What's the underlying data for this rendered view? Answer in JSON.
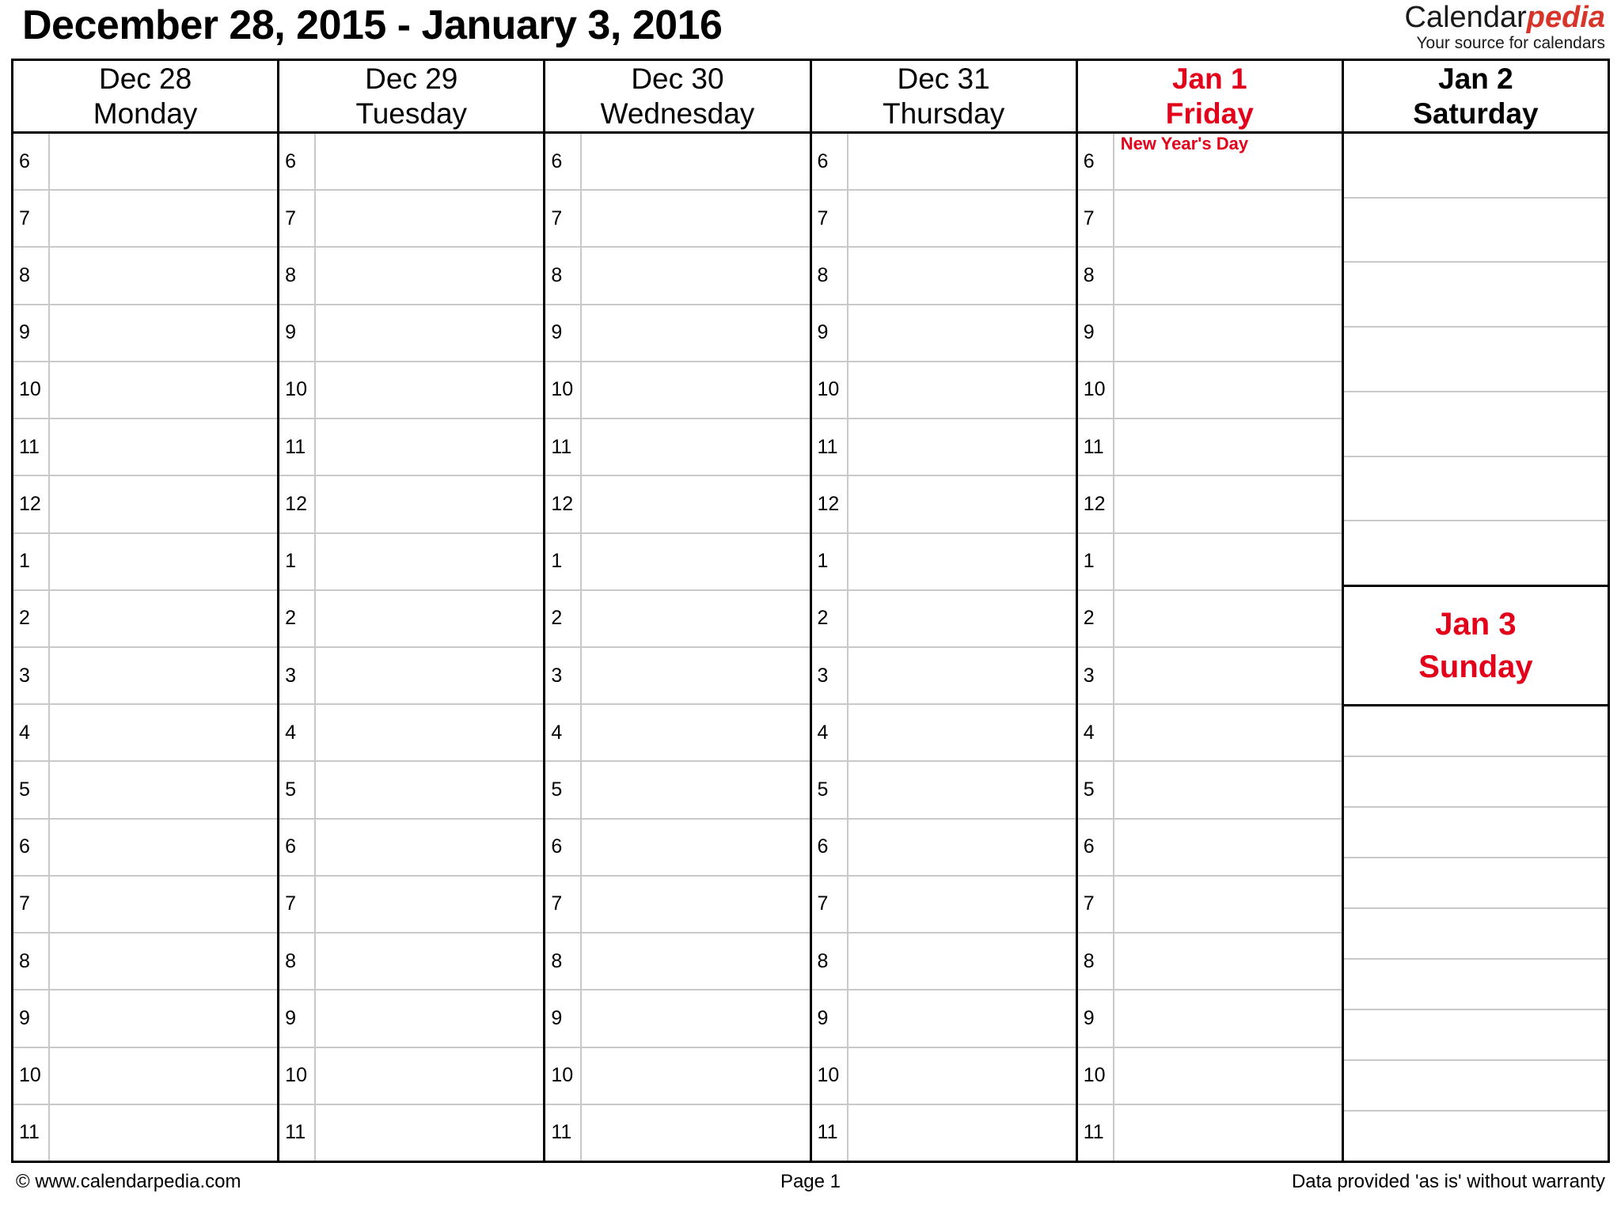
{
  "header": {
    "title": "December 28, 2015 - January 3, 2016",
    "brand_part1": "Calendar",
    "brand_part2": "pedia",
    "brand_tagline": "Your source for calendars"
  },
  "colors": {
    "holiday_red": "#e2001a",
    "brand_red": "#d8352a",
    "grid_line": "#c9c9c9",
    "border": "#000000"
  },
  "hours": [
    "6",
    "7",
    "8",
    "9",
    "10",
    "11",
    "12",
    "1",
    "2",
    "3",
    "4",
    "5",
    "6",
    "7",
    "8",
    "9",
    "10",
    "11"
  ],
  "days": [
    {
      "date": "Dec 28",
      "weekday": "Monday",
      "style": "weekday"
    },
    {
      "date": "Dec 29",
      "weekday": "Tuesday",
      "style": "weekday"
    },
    {
      "date": "Dec 30",
      "weekday": "Wednesday",
      "style": "weekday"
    },
    {
      "date": "Dec 31",
      "weekday": "Thursday",
      "style": "weekday"
    },
    {
      "date": "Jan 1",
      "weekday": "Friday",
      "style": "holiday"
    }
  ],
  "events": {
    "jan1_hour6": "New Year's Day"
  },
  "weekend": {
    "saturday": {
      "date": "Jan 2",
      "weekday": "Saturday"
    },
    "sunday": {
      "date": "Jan 3",
      "weekday": "Sunday"
    }
  },
  "footer": {
    "left": "© www.calendarpedia.com",
    "middle": "Page 1",
    "right": "Data provided 'as is' without warranty"
  }
}
